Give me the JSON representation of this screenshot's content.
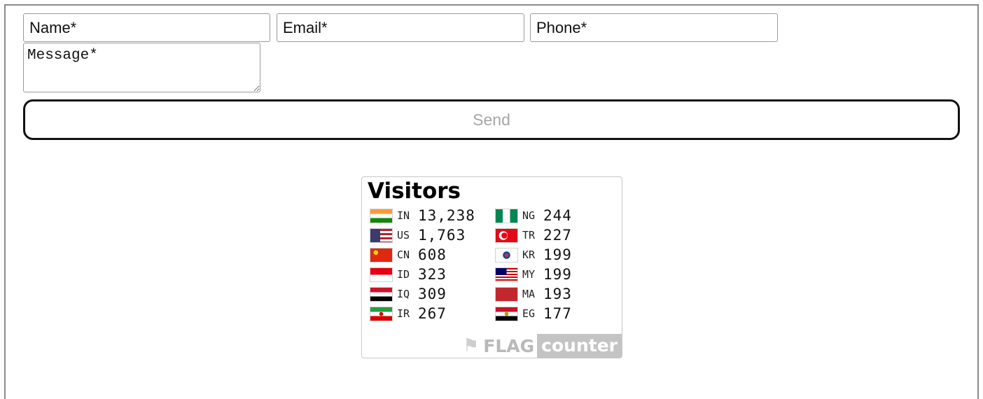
{
  "form": {
    "name_placeholder": "Name*",
    "email_placeholder": "Email*",
    "phone_placeholder": "Phone*",
    "message_placeholder": "Message*",
    "send_label": "Send"
  },
  "flag_counter": {
    "title": "Visitors",
    "left_column": [
      {
        "code": "IN",
        "count": "13,238",
        "flag": "india-flag-icon"
      },
      {
        "code": "US",
        "count": "1,763",
        "flag": "usa-flag-icon"
      },
      {
        "code": "CN",
        "count": "608",
        "flag": "china-flag-icon"
      },
      {
        "code": "ID",
        "count": "323",
        "flag": "indonesia-flag-icon"
      },
      {
        "code": "IQ",
        "count": "309",
        "flag": "iraq-flag-icon"
      },
      {
        "code": "IR",
        "count": "267",
        "flag": "iran-flag-icon"
      }
    ],
    "right_column": [
      {
        "code": "NG",
        "count": "244",
        "flag": "nigeria-flag-icon"
      },
      {
        "code": "TR",
        "count": "227",
        "flag": "turkey-flag-icon"
      },
      {
        "code": "KR",
        "count": "199",
        "flag": "south-korea-flag-icon"
      },
      {
        "code": "MY",
        "count": "199",
        "flag": "malaysia-flag-icon"
      },
      {
        "code": "MA",
        "count": "193",
        "flag": "morocco-flag-icon"
      },
      {
        "code": "EG",
        "count": "177",
        "flag": "egypt-flag-icon"
      }
    ],
    "logo_flag": "FLAG",
    "logo_counter": "counter"
  },
  "colors": {
    "send_text": "#a6a6a6",
    "border": "#111111"
  }
}
